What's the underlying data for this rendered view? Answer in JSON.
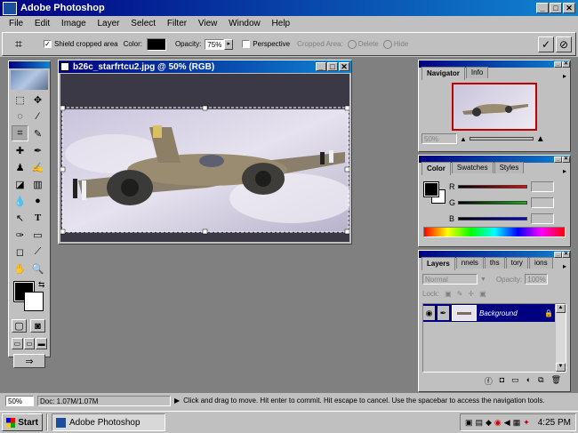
{
  "app": {
    "title": "Adobe Photoshop"
  },
  "menu": [
    "File",
    "Edit",
    "Image",
    "Layer",
    "Select",
    "Filter",
    "View",
    "Window",
    "Help"
  ],
  "options": {
    "shield_label": "Shield cropped area",
    "color_label": "Color:",
    "opacity_label": "Opacity:",
    "opacity_value": "75%",
    "perspective_label": "Perspective",
    "cropped_area_label": "Cropped Area:",
    "delete_label": "Delete",
    "hide_label": "Hide",
    "shield_color": "#000000"
  },
  "document": {
    "title": "b26c_starfrtcu2.jpg @ 50% (RGB)"
  },
  "navigator": {
    "tabs": [
      "Navigator",
      "Info"
    ],
    "zoom": "50%"
  },
  "color_panel": {
    "tabs": [
      "Color",
      "Swatches",
      "Styles"
    ],
    "channels": [
      "R",
      "G",
      "B"
    ],
    "slider_colors": [
      "#ff0000",
      "#00c000",
      "#0000ff"
    ]
  },
  "layers": {
    "tabs": [
      "Layers",
      "nnels",
      "ths",
      "tory",
      "ions"
    ],
    "blend_mode": "Normal",
    "opacity_label": "Opacity:",
    "opacity_value": "100%",
    "lock_label": "Lock:",
    "layer_name": "Background"
  },
  "status": {
    "zoom": "50%",
    "doc": "Doc: 1.07M/1.07M",
    "message": "Click and drag to move. Hit enter to commit. Hit escape to cancel. Use the spacebar to access the navigation tools."
  },
  "taskbar": {
    "start": "Start",
    "task": "Adobe Photoshop",
    "clock": "4:25 PM"
  },
  "colors": {
    "title_blue": "#000080",
    "workspace": "#808080",
    "selection_blue": "#000080"
  }
}
